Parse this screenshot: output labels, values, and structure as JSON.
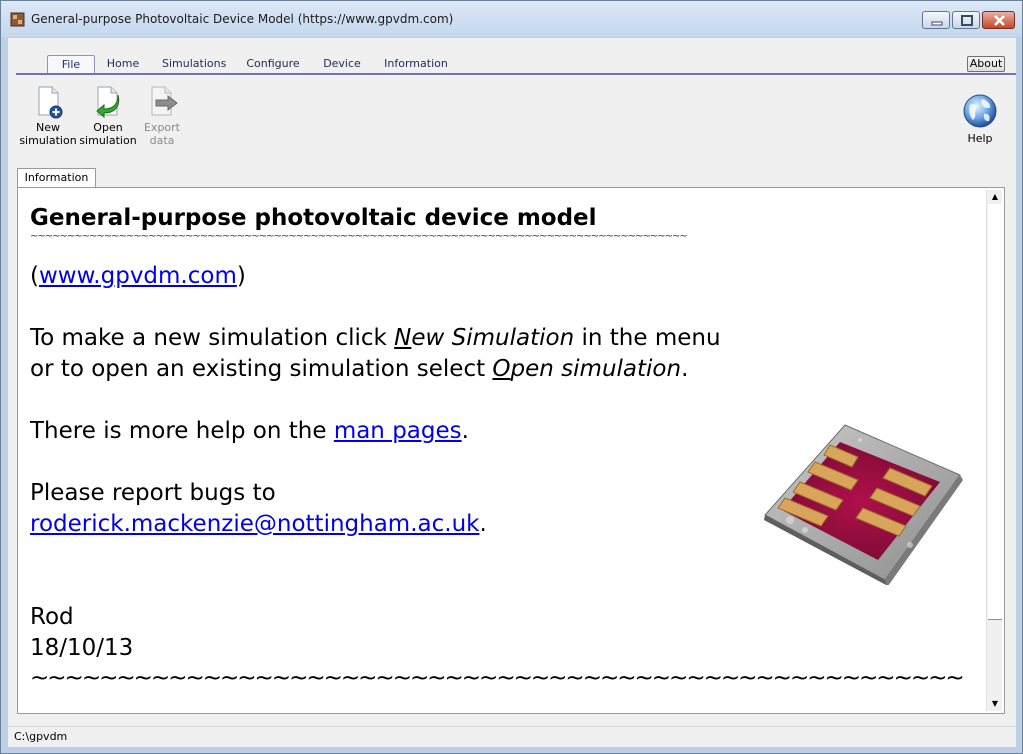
{
  "window": {
    "title": "General-purpose Photovoltaic Device Model (https://www.gpvdm.com)"
  },
  "tabs": [
    {
      "label": "File",
      "active": true
    },
    {
      "label": "Home"
    },
    {
      "label": "Simulations"
    },
    {
      "label": "Configure"
    },
    {
      "label": "Device"
    },
    {
      "label": "Information"
    }
  ],
  "about_label": "About",
  "toolbar": {
    "new_simulation": {
      "line1": "New",
      "line2": "simulation",
      "icon": "new-document-icon"
    },
    "open_simulation": {
      "line1": "Open",
      "line2": "simulation",
      "icon": "open-document-icon"
    },
    "export_data": {
      "line1": "Export",
      "line2": "data",
      "icon": "export-icon",
      "enabled": false
    },
    "help": {
      "label": "Help",
      "icon": "globe-help-icon"
    }
  },
  "panel_tab": "Information",
  "document": {
    "heading": "General-purpose photovoltaic device model",
    "rule_small": "~~~~~~~~~~~~~~~~~~~~~~~~~~~~~~~~~~~~~~~~~~~~~~~~~~~~~~~~~~~~~~~~~~~~~~~~~~~~~~~~~~~~~~~~~",
    "open_paren": "(",
    "site_link": "www.gpvdm.com",
    "close_paren": ")",
    "line1_pre": "To make a new simulation click ",
    "line1_em_first": "N",
    "line1_em_rest": "ew Simulation",
    "line1_post": " in the menu",
    "line2_pre": "or to open an existing simulation select ",
    "line2_em_first": "O",
    "line2_em_rest": "pen simulation",
    "line2_post": ".",
    "help_pre": "There is more help on the ",
    "help_link": "man pages",
    "help_post": ".",
    "bugs_line": "Please report bugs to",
    "email_link": "roderick.mackenzie@nottingham.ac.uk",
    "email_post": ".",
    "signature": "Rod",
    "date": "18/10/13",
    "rule_big": "~~~~~~~~~~~~~~~~~~~~~~~~~~~~~~~~~~~~~~~~~~~~~~~~~~~~~~"
  },
  "status": {
    "path": "C:\\gpvdm"
  },
  "colors": {
    "link": "#0000ee",
    "ribbon_line": "#6f73b4",
    "close_button": "#c6462b"
  }
}
